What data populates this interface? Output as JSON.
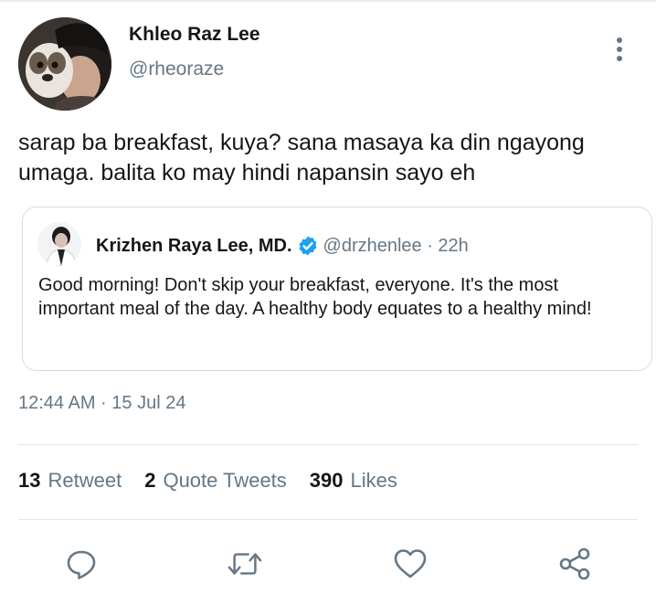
{
  "author": {
    "name": "Khleo Raz Lee",
    "handle": "@rheoraze"
  },
  "tweet": {
    "text": "sarap ba breakfast, kuya? sana masaya ka din ngayong umaga. balita ko may hindi napansin sayo eh",
    "timestamp": "12:44 AM · 15 Jul 24"
  },
  "quoted": {
    "name": "Krizhen Raya Lee, MD.",
    "handle_time": "@drzhenlee · 22h",
    "text": "Good morning! Don't skip your breakfast, everyone. It's the most important meal of the day. A healthy body equates to a healthy mind!"
  },
  "stats": {
    "retweets_count": "13",
    "retweets_label": "Retweet",
    "quotes_count": "2",
    "quotes_label": "Quote Tweets",
    "likes_count": "390",
    "likes_label": "Likes"
  },
  "icons": {
    "more": "more-vertical-icon",
    "verified": "verified-badge-icon",
    "reply": "reply-icon",
    "retweet": "retweet-icon",
    "like": "heart-icon",
    "share": "share-icon"
  },
  "colors": {
    "text": "#14171a",
    "secondary": "#657786",
    "verified_blue": "#1da1f2",
    "border": "#d6dde3"
  }
}
